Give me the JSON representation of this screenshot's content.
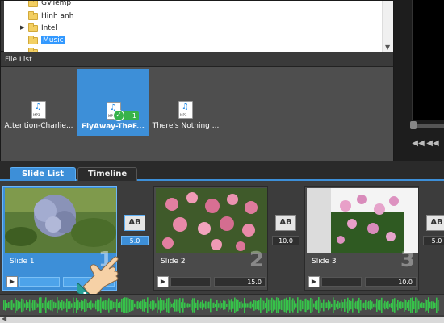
{
  "folder_tree": {
    "items": [
      {
        "label": "GVTemp",
        "selected": false,
        "expandable": false
      },
      {
        "label": "Hinh anh",
        "selected": false,
        "expandable": false
      },
      {
        "label": "Intel",
        "selected": false,
        "expandable": true
      },
      {
        "label": "Music",
        "selected": true,
        "expandable": false
      }
    ]
  },
  "file_list": {
    "header": "File List",
    "files": [
      {
        "name": "Attention-Charlie...",
        "type": "MP3",
        "selected": false
      },
      {
        "name": "FlyAway-TheF...",
        "type": "MP3",
        "selected": true,
        "use_count": "1"
      },
      {
        "name": "There's Nothing ...",
        "type": "MP3",
        "selected": false
      }
    ]
  },
  "tabs": [
    {
      "label": "Slide List",
      "active": true
    },
    {
      "label": "Timeline",
      "active": false
    }
  ],
  "slides": [
    {
      "label": "Slide 1",
      "number": "1",
      "duration": "10.0",
      "selected": true
    },
    {
      "label": "Slide 2",
      "number": "2",
      "duration": "15.0",
      "selected": false
    },
    {
      "label": "Slide 3",
      "number": "3",
      "duration": "10.0",
      "selected": false
    }
  ],
  "transitions": [
    {
      "icon": "AB",
      "time": "5.0",
      "active": true
    },
    {
      "icon": "AB",
      "time": "10.0",
      "active": false
    },
    {
      "icon": "AB",
      "time": "10.0",
      "active": false
    },
    {
      "icon": "AB",
      "time": "5.0",
      "active": false
    }
  ],
  "icons": {
    "play": "play-icon",
    "transition": "transition-ab-icon",
    "rewind": "rewind-icon",
    "step_back": "step-back-icon",
    "hand": "hand-pointer-icon"
  },
  "colors": {
    "accent": "#3d8fd8",
    "waveform": "#37c24a"
  }
}
